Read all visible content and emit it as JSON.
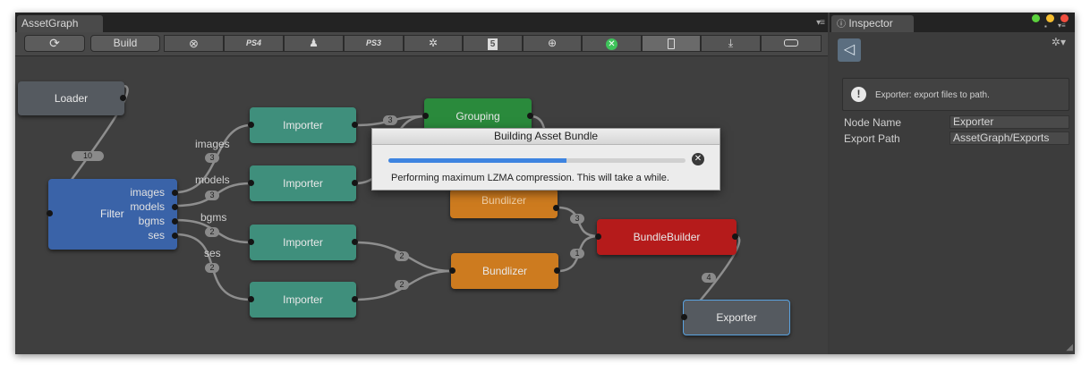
{
  "graph_window": {
    "title": "AssetGraph",
    "menu_icon": "tab-menu-icon",
    "toolbar": {
      "refresh_icon": "refresh-icon",
      "build_label": "Build",
      "platforms": [
        {
          "label": "",
          "icon": "xbox-icon"
        },
        {
          "label": "PS4",
          "icon": "ps4-icon"
        },
        {
          "label": "",
          "icon": "android-icon"
        },
        {
          "label": "PS3",
          "icon": "ps3-icon"
        },
        {
          "label": "",
          "icon": "unity-logo-icon"
        },
        {
          "label": "5",
          "icon": "html5-icon"
        },
        {
          "label": "",
          "icon": "globe-icon"
        },
        {
          "label": "",
          "icon": "xbox-one-icon"
        },
        {
          "label": "",
          "icon": "mobile-icon"
        },
        {
          "label": "",
          "icon": "download-icon"
        },
        {
          "label": "",
          "icon": "console-icon"
        }
      ]
    }
  },
  "nodes": {
    "loader": "Loader",
    "filter": "Filter",
    "filter_outputs": [
      "images",
      "models",
      "bgms",
      "ses"
    ],
    "importer": "Importer",
    "grouping": "Grouping",
    "bundlizer": "Bundlizer",
    "bundle_builder": "BundleBuilder",
    "exporter": "Exporter"
  },
  "edge_labels": {
    "images": "images",
    "models": "models",
    "bgms": "bgms",
    "ses": "ses"
  },
  "edge_counts": {
    "loader_filter": "10",
    "images": "3",
    "models": "3",
    "bgms": "2",
    "ses": "2",
    "importer_grouping": "3",
    "importer3_bundlizer": "2",
    "importer4_bundlizer": "2",
    "bundlizer1_builder": "3",
    "bundlizer2_builder": "1",
    "builder_exporter": "4"
  },
  "dialog": {
    "title": "Building Asset Bundle",
    "progress": 0.6,
    "message": "Performing maximum LZMA compression. This will take a while.",
    "close_icon": "close-circle-icon"
  },
  "inspector": {
    "title": "Inspector",
    "help": "Exporter: export files to path.",
    "fields": [
      {
        "label": "Node Name",
        "value": "Exporter"
      },
      {
        "label": "Export Path",
        "value": "AssetGraph/Exports"
      }
    ]
  },
  "colors": {
    "teal": "#3f8f7c",
    "green": "#2a8a3c",
    "blue": "#3a63a8",
    "orange": "#cd7b1f",
    "red": "#b51b1b",
    "gray_node": "#555a60",
    "progress": "#3e84e0"
  }
}
